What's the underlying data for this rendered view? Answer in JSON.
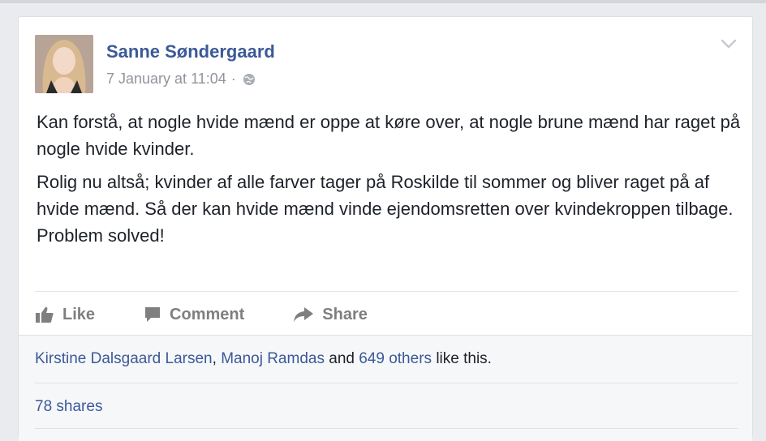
{
  "post": {
    "author": "Sanne Søndergaard",
    "timestamp": "7 January at 11:04",
    "separator": "·",
    "privacy_icon": "globe-icon",
    "menu_icon": "chevron-down-icon",
    "paragraphs": [
      "Kan forstå, at nogle hvide mænd er oppe at køre over, at nogle brune mænd har raget på nogle hvide kvinder.",
      "Rolig nu altså; kvinder af alle farver tager på Roskilde til sommer og bliver raget på af hvide mænd. Så der kan hvide mænd vinde ejendomsretten over kvindekroppen tilbage.",
      "Problem solved!"
    ]
  },
  "actions": {
    "like_label": "Like",
    "comment_label": "Comment",
    "share_label": "Share"
  },
  "reactions": {
    "name1": "Kirstine Dalsgaard Larsen",
    "sep": ",",
    "name2": "Manoj Ramdas",
    "and_text": "and",
    "others": "649 others",
    "like_this": "like this."
  },
  "shares_label": "78 shares",
  "colors": {
    "link": "#3b5998",
    "muted": "#90949c",
    "icon": "#7f7f7f"
  }
}
